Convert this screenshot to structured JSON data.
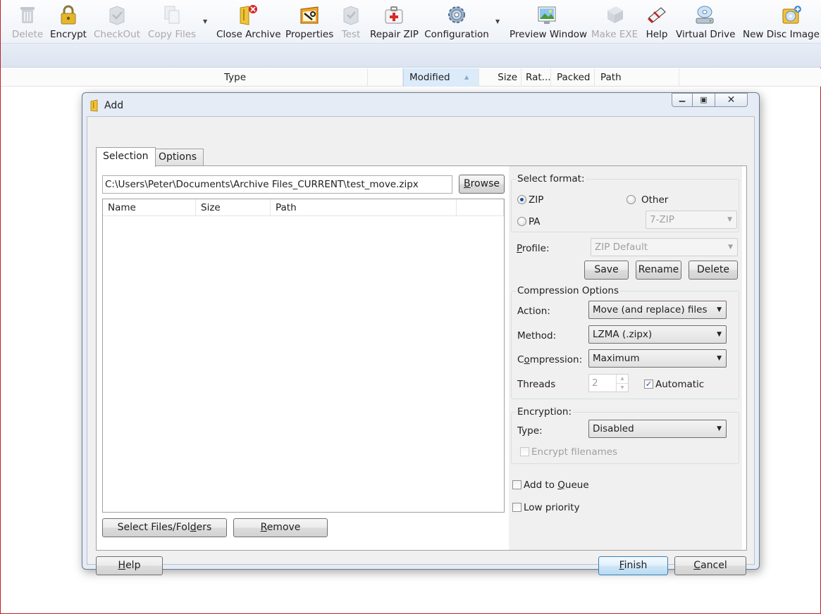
{
  "toolbar": {
    "items": [
      {
        "label": "Delete",
        "icon": "delete-icon",
        "enabled": false
      },
      {
        "label": "Encrypt",
        "icon": "padlock-icon",
        "enabled": true
      },
      {
        "label": "CheckOut",
        "icon": "checkout-icon",
        "enabled": false
      },
      {
        "label": "Copy Files",
        "icon": "copy-files-icon",
        "enabled": false
      },
      {
        "label": "Close Archive",
        "icon": "close-archive-icon",
        "enabled": true
      },
      {
        "label": "Properties",
        "icon": "properties-icon",
        "enabled": true
      },
      {
        "label": "Test",
        "icon": "test-icon",
        "enabled": false
      },
      {
        "label": "Repair ZIP",
        "icon": "repair-zip-icon",
        "enabled": true
      },
      {
        "label": "Configuration",
        "icon": "gear-icon",
        "enabled": true
      },
      {
        "label": "Preview Window",
        "icon": "preview-window-icon",
        "enabled": true
      },
      {
        "label": "Make EXE",
        "icon": "make-exe-icon",
        "enabled": false
      },
      {
        "label": "Help",
        "icon": "help-icon",
        "enabled": true
      },
      {
        "label": "Virtual Drive",
        "icon": "virtual-drive-icon",
        "enabled": true
      },
      {
        "label": "New Disc Image (.i",
        "icon": "new-disc-image-icon",
        "enabled": true
      }
    ]
  },
  "columns": {
    "type": "Type",
    "modified": "Modified",
    "size": "Size",
    "ratio": "Rat...",
    "packed": "Packed",
    "path": "Path"
  },
  "dialog": {
    "title": "Add",
    "tabs": {
      "selection": "Selection",
      "options": "Options"
    },
    "archive_path": "C:\\Users\\Peter\\Documents\\Archive Files_CURRENT\\test_move.zipx",
    "browse_pre": "",
    "browse_key": "B",
    "browse_post": "rowse",
    "file_columns": {
      "name": "Name",
      "size": "Size",
      "path": "Path"
    },
    "select_files_pre": "Select Files/Fol",
    "select_files_key": "d",
    "select_files_post": "ers",
    "remove_pre": "",
    "remove_key": "R",
    "remove_post": "emove",
    "format": {
      "title": "Select format:",
      "zip": "ZIP",
      "other": "Other",
      "pa": "PA",
      "other_value": "7-ZIP",
      "selected": "ZIP"
    },
    "profile": {
      "label_pre": "",
      "label_key": "P",
      "label_post": "rofile:",
      "value": "ZIP Default",
      "save": "Save",
      "rename": "Rename",
      "delete": "Delete"
    },
    "compression": {
      "title": "Compression Options",
      "action_label": "Action:",
      "action_value": "Move (and replace) files",
      "method_label": "Method:",
      "method_value": "LZMA (.zipx)",
      "compression_label_pre": "C",
      "compression_label_key": "o",
      "compression_label_post": "mpression:",
      "compression_value": "Maximum",
      "threads_label": "Threads",
      "threads_value": "2",
      "automatic_label": "Automatic",
      "automatic_checked": true
    },
    "encryption": {
      "title": "Encryption:",
      "type_label": "Type:",
      "type_value": "Disabled",
      "encrypt_filenames": "Encrypt filenames"
    },
    "add_to_queue_pre": "Add to ",
    "add_to_queue_key": "Q",
    "add_to_queue_post": "ueue",
    "low_priority": "Low priority",
    "help_pre": "",
    "help_key": "H",
    "help_post": "elp",
    "finish_pre": "",
    "finish_key": "F",
    "finish_post": "inish",
    "cancel_pre": "",
    "cancel_key": "C",
    "cancel_post": "ancel"
  }
}
